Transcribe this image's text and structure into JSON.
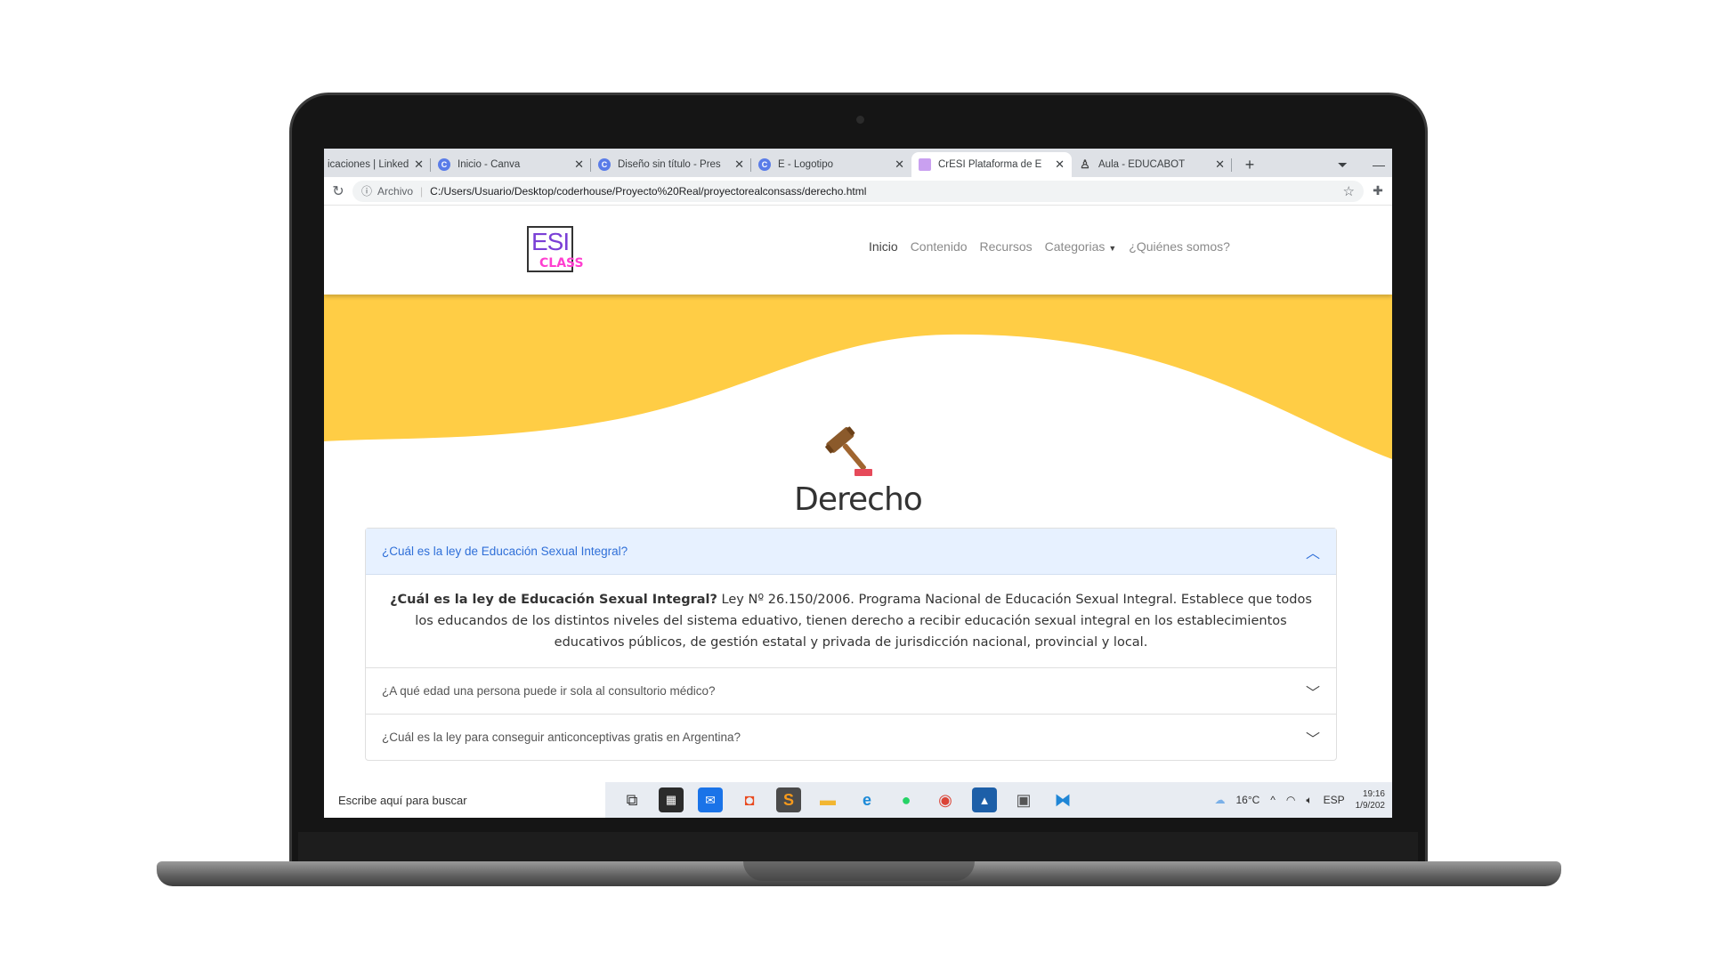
{
  "browser": {
    "tabs": [
      {
        "label": "icaciones | Linked",
        "favicon": "linkedin-icon"
      },
      {
        "label": "Inicio - Canva",
        "favicon": "canva-icon"
      },
      {
        "label": "Diseño sin título - Pres",
        "favicon": "canva-icon"
      },
      {
        "label": "E - Logotipo",
        "favicon": "canva-icon"
      },
      {
        "label": "CrESI Plataforma de E",
        "favicon": "cresi-icon",
        "active": true
      },
      {
        "label": "Aula - EDUCABOT",
        "favicon": "educabot-icon"
      }
    ],
    "address": {
      "scheme": "Archivo",
      "url": "C:/Users/Usuario/Desktop/coderhouse/Proyecto%20Real/proyectorealconsass/derecho.html"
    }
  },
  "site": {
    "logo": {
      "top": "ESI",
      "bottom": "CLASS"
    },
    "nav": {
      "inicio": "Inicio",
      "contenido": "Contenido",
      "recursos": "Recursos",
      "categorias": "Categorias",
      "quienes": "¿Quiénes somos?"
    },
    "colors": {
      "hero": "#ffcd45",
      "accent": "#2f6fd8"
    },
    "title": "Derecho",
    "faq": [
      {
        "question": "¿Cuál es la ley de Educación Sexual Integral?",
        "open": true,
        "answer_bold": "¿Cuál es la ley de Educación Sexual Integral?",
        "answer": " Ley Nº 26.150/2006. Programa Nacional de Educación Sexual Integral. Establece que todos los educandos de los distintos niveles del sistema eduativo, tienen derecho a recibir educación sexual integral en los establecimientos educativos públicos, de gestión estatal y privada de jurisdicción nacional, provincial y local."
      },
      {
        "question": "¿A qué edad una persona puede ir sola al consultorio médico?",
        "open": false
      },
      {
        "question": "¿Cuál es la ley para conseguir anticonceptivas gratis en Argentina?",
        "open": false
      }
    ]
  },
  "taskbar": {
    "search_placeholder": "Escribe aquí para buscar",
    "temperature": "16°C",
    "language": "ESP",
    "time": "19:16",
    "date": "1/9/202"
  }
}
